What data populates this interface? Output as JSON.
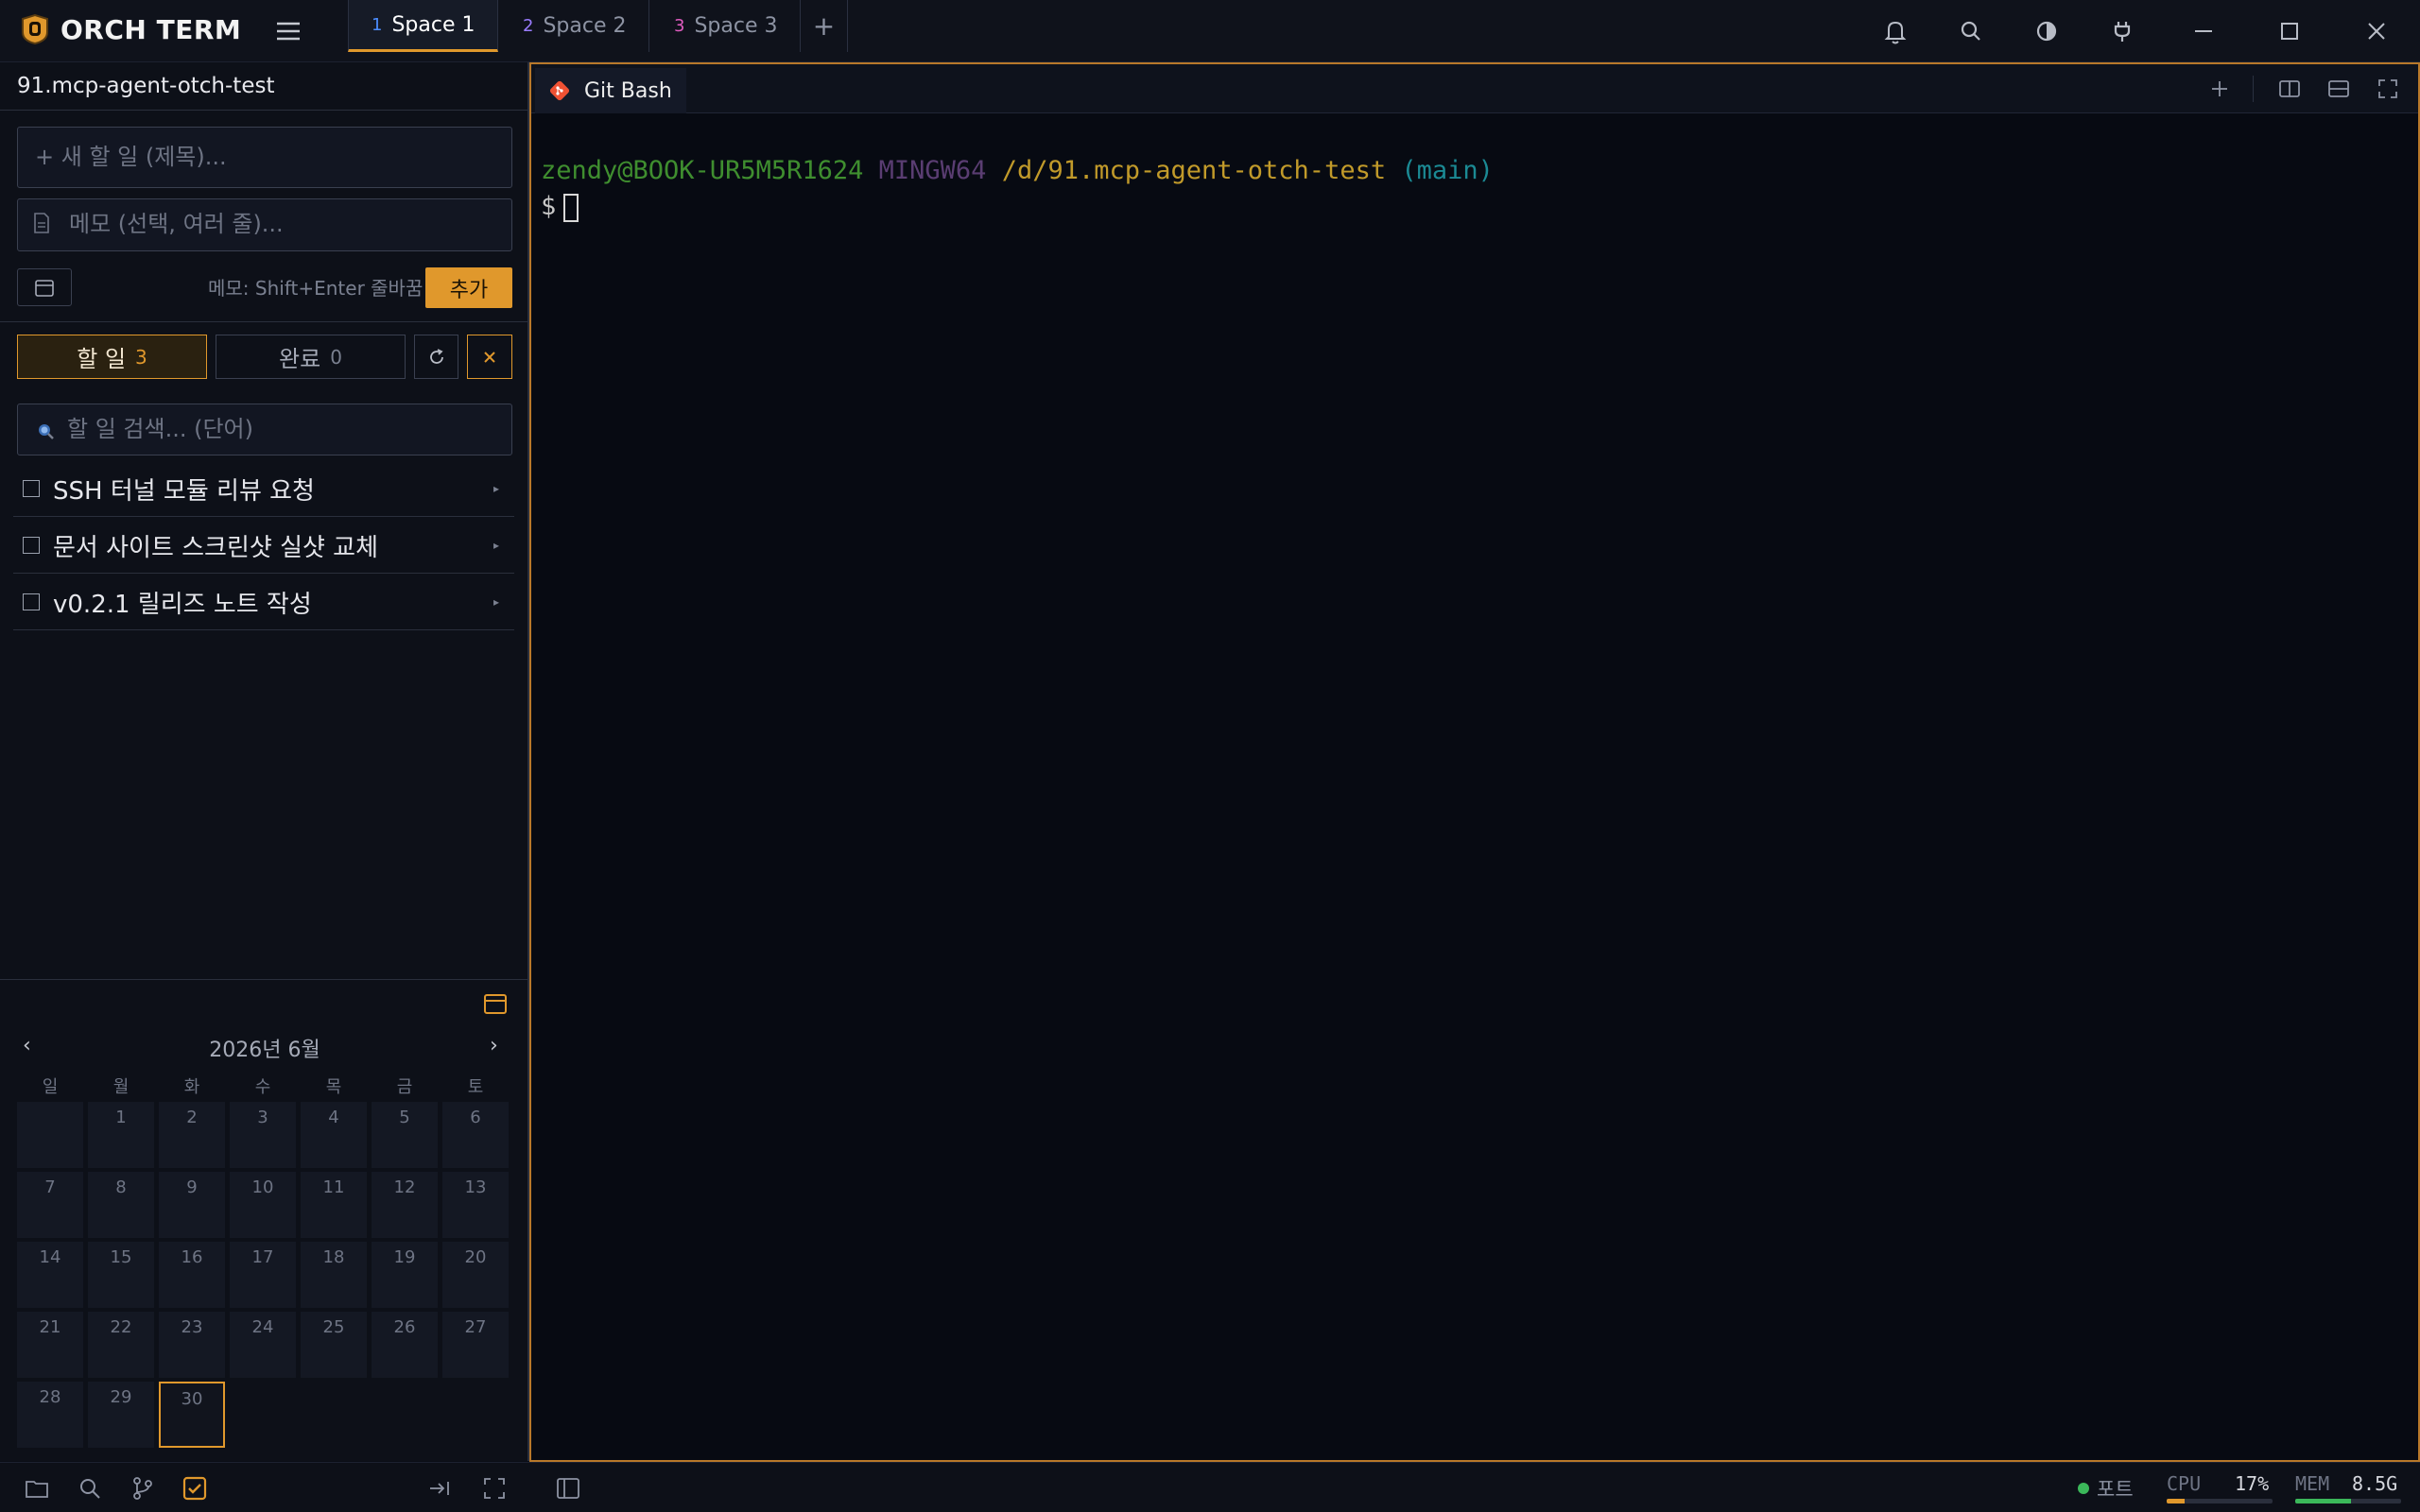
{
  "app": {
    "title": "ORCH TERM"
  },
  "spaces": [
    {
      "num": "1",
      "label": "Space 1",
      "color": "#4c8dff",
      "active": true
    },
    {
      "num": "2",
      "label": "Space 2",
      "color": "#9a7cff"
    },
    {
      "num": "3",
      "label": "Space 3",
      "color": "#e05cc0"
    }
  ],
  "add_space": "+",
  "sidebar": {
    "project": "91.mcp-agent-otch-test",
    "new_todo_placeholder": "+ 새 할 일 (제목)...",
    "memo_placeholder": "메모 (선택, 여러 줄)...",
    "memo_hint": "메모: Shift+Enter 줄바꿈",
    "add_label": "추가",
    "tabs": [
      {
        "label": "할 일",
        "count": "3"
      },
      {
        "label": "완료",
        "count": "0"
      }
    ],
    "search_placeholder": "할 일 검색... (단어)",
    "todos": [
      {
        "text": "SSH 터널 모듈 리뷰 요청",
        "arrow": "▸"
      },
      {
        "text": "문서 사이트 스크린샷 실샷 교체",
        "arrow": "▸"
      },
      {
        "text": "v0.2.1 릴리즈 노트 작성",
        "arrow": "▸"
      }
    ]
  },
  "calendar": {
    "month_label": "2026년 6월",
    "prev": "‹",
    "next": "›",
    "weekdays": [
      "일",
      "월",
      "화",
      "수",
      "목",
      "금",
      "토"
    ],
    "first_weekday_index": 1,
    "days_in_month": 30,
    "today": 30
  },
  "terminal": {
    "tab_label": "Git Bash",
    "user": "zendy@BOOK-UR5M5R1624",
    "system": "MINGW64",
    "path": "/d/91.mcp-agent-otch-test",
    "branch": "(main)",
    "prompt": "$"
  },
  "status": {
    "port_label": "포트",
    "cpu_label": "CPU",
    "cpu_value": "17%",
    "cpu_fraction": 0.17,
    "mem_label": "MEM",
    "mem_value": "8.5G",
    "mem_fraction": 0.53,
    "colors": {
      "cpu": "#e0982c",
      "mem": "#3bb85a",
      "accent": "#e0982c"
    }
  }
}
